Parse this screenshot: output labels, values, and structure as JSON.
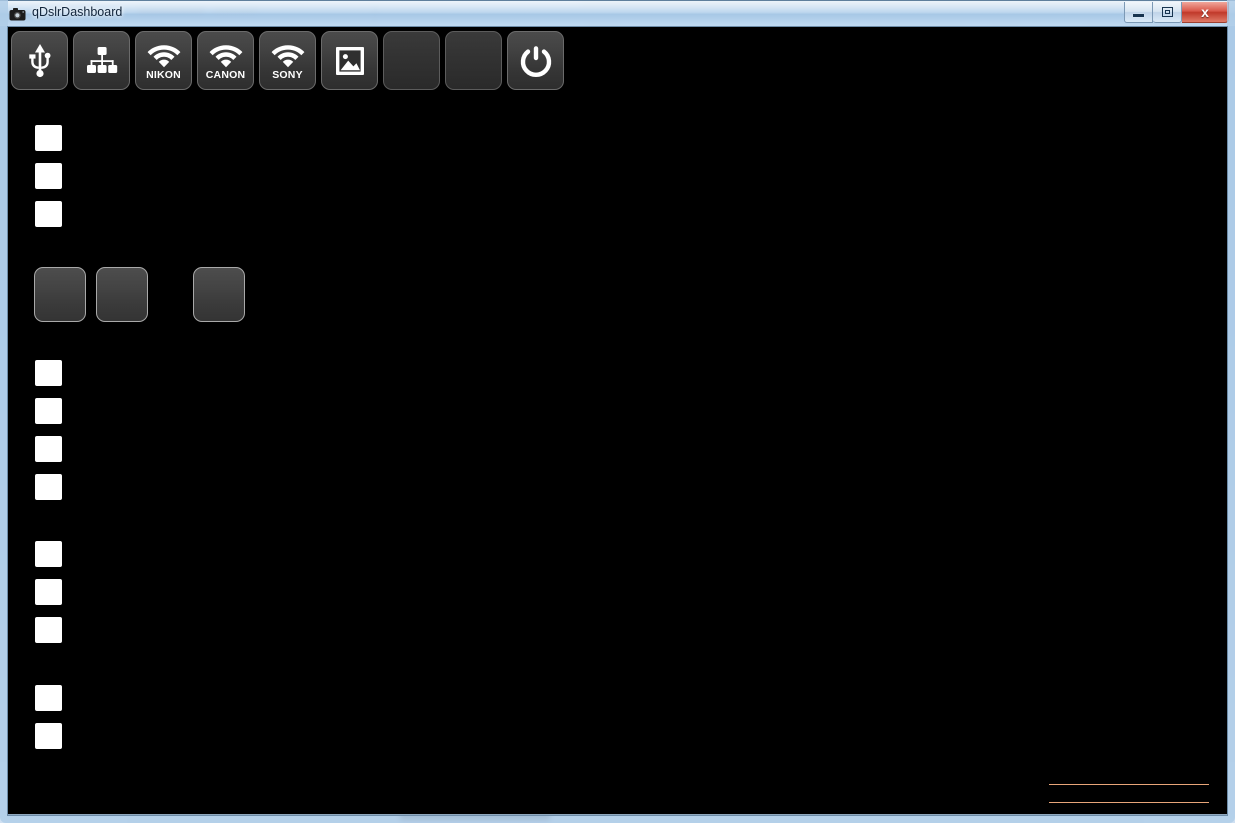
{
  "window": {
    "title": "qDslrDashboard",
    "icon": "camera-icon",
    "controls": {
      "minimize_label": "Minimize",
      "restore_label": "Restore",
      "close_label": "x"
    }
  },
  "toolbar": {
    "buttons": [
      {
        "name": "usb-connect",
        "icon": "usb-icon",
        "label": "",
        "enabled": true
      },
      {
        "name": "network-connect",
        "icon": "network-tree-icon",
        "label": "",
        "enabled": true
      },
      {
        "name": "nikon-wifi",
        "icon": "wifi-icon",
        "label": "NIKON",
        "enabled": true
      },
      {
        "name": "canon-wifi",
        "icon": "wifi-icon",
        "label": "CANON",
        "enabled": true
      },
      {
        "name": "sony-wifi",
        "icon": "wifi-icon",
        "label": "SONY",
        "enabled": true
      },
      {
        "name": "gallery",
        "icon": "image-icon",
        "label": "",
        "enabled": true
      },
      {
        "name": "toolbar-empty-1",
        "icon": "",
        "label": "",
        "enabled": false
      },
      {
        "name": "toolbar-empty-2",
        "icon": "",
        "label": "",
        "enabled": false
      },
      {
        "name": "power-exit",
        "icon": "power-icon",
        "label": "",
        "enabled": true
      }
    ]
  },
  "panel": {
    "group1": {
      "boxes": [
        "",
        "",
        ""
      ]
    },
    "group2_buttons": {
      "buttons": [
        "",
        "",
        ""
      ]
    },
    "group3": {
      "boxes": [
        "",
        "",
        "",
        ""
      ]
    },
    "group4": {
      "boxes": [
        "",
        "",
        ""
      ]
    },
    "group5": {
      "boxes": [
        "",
        ""
      ]
    }
  },
  "footer": {
    "separator_color": "#e8a579",
    "lines": [
      "",
      ""
    ]
  },
  "colors": {
    "background": "#000000",
    "titlebar": "#b9d4ed",
    "close_button": "#c0392a",
    "accent_orange": "#e8a579",
    "box_fill": "#ffffff"
  }
}
